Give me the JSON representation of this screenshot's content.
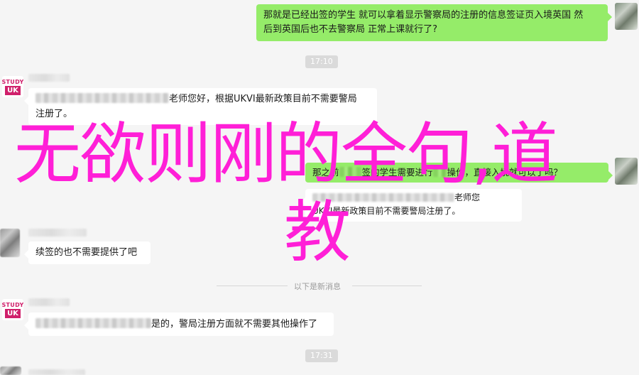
{
  "messages": {
    "m1_right": {
      "line1": "那就是已经出签的学生 就可以拿着显示警察局的注册的信息签证页入境英国 然",
      "line2": "后到英国后也不去警察局 正常上课就行了?"
    },
    "time1": "17:10",
    "m2_left": {
      "line1_suffix": "老师您好，根据UKVI最新政策目前不需要警局",
      "line2": "注册了。"
    },
    "m3_right": {
      "prefix": "那之前",
      "middle": "签的学生需要进行",
      "suffix": "操作，直接入境就可以了吗？"
    },
    "m4_left": {
      "head": "老师您",
      "body": "UKVI最新政策目前不需要警局注册了。"
    },
    "m5_left": {
      "text": "续签的也不需要提供了吧"
    },
    "divider": "以下是新消息",
    "m6_left": {
      "suffix": "是的，警局注册方面就不需要其他操作了"
    },
    "time2": "17:31"
  },
  "avatars": {
    "study_uk": {
      "top": "STUDY",
      "bottom": "UK"
    }
  },
  "overlay": {
    "line1": "无欲则刚的全句,道",
    "line2": "教",
    "color": "#ff1fd7"
  },
  "colors": {
    "bubble_right": "#95ec69",
    "bubble_left": "#ffffff",
    "background": "#f5f5f5"
  }
}
